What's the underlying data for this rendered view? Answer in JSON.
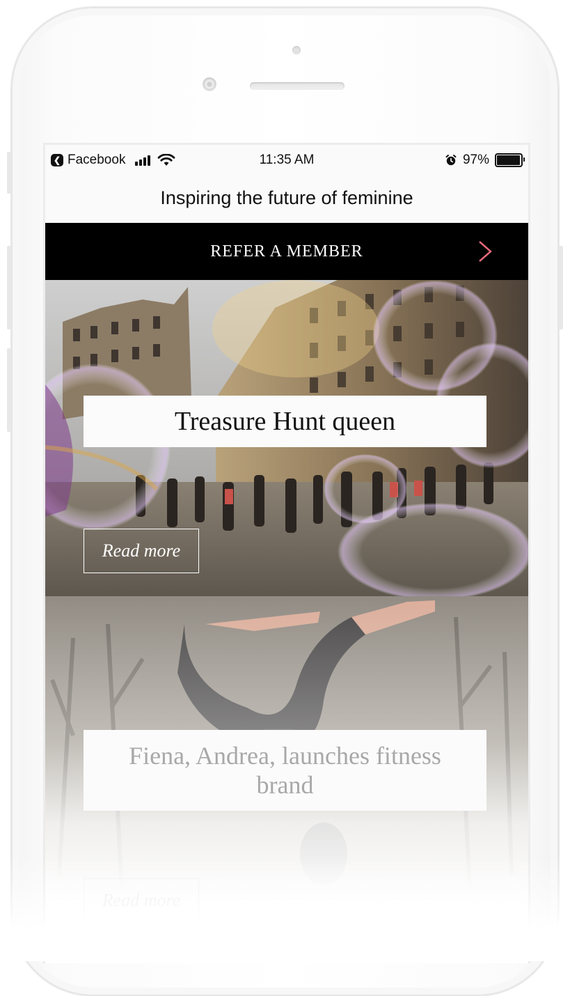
{
  "status_bar": {
    "back_app": "Facebook",
    "time": "11:35 AM",
    "battery": "97%",
    "battery_level": 0.97,
    "icons": [
      "back-arrow-icon",
      "cellular-signal-icon",
      "wifi-icon",
      "alarm-icon",
      "battery-icon"
    ]
  },
  "header": {
    "tagline": "Inspiring the future of feminine"
  },
  "refer_banner": {
    "label": "REFER A MEMBER",
    "chevron_color": "#e5697a"
  },
  "articles": [
    {
      "title": "Treasure Hunt queen",
      "cta": "Read more"
    },
    {
      "title": "Fiena, Andrea, launches fitness brand",
      "cta": "Read more"
    }
  ],
  "colors": {
    "banner_bg": "#000000",
    "accent": "#e5697a",
    "title_box_bg": "#fbfbfb"
  }
}
